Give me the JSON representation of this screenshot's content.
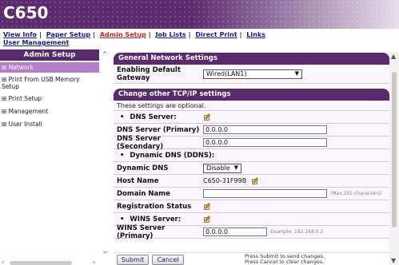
{
  "app": {
    "title": "C650"
  },
  "nav": {
    "line1": [
      "View Info",
      "Paper Setup",
      "Admin Setup",
      "Job Lists",
      "Direct Print",
      "Links"
    ],
    "line2": "User Management"
  },
  "sidebar": {
    "title": "Admin Setup",
    "items": [
      {
        "label": "⊞ Network"
      },
      {
        "label": "⊞ Print From USB Memory Setup"
      },
      {
        "label": "⊞ Print Setup"
      },
      {
        "label": "⊞ Management"
      },
      {
        "label": "⊞ User Install"
      }
    ]
  },
  "sections": {
    "general": {
      "title": "General Network Settings",
      "gateway_label": "Enabling Default Gateway",
      "gateway_value": "Wired(LAN1)"
    },
    "tcpip": {
      "title": "Change other TCP/IP settings",
      "note": "These settings are optional.",
      "dns_server_label": "DNS Server:",
      "dns_primary_label": "DNS Server (Primary)",
      "dns_primary_value": "0.0.0.0",
      "dns_secondary_label": "DNS Server (Secondary)",
      "dns_secondary_value": "0.0.0.0",
      "ddns_label": "Dynamic DNS (DDNS):",
      "dynamic_dns_label": "Dynamic DNS",
      "dynamic_dns_value": "Disable",
      "host_name_label": "Host Name",
      "host_name_value": "C650-31F99B",
      "domain_name_label": "Domain Name",
      "domain_name_value": "",
      "domain_name_hint": "(Max.255 characters)",
      "reg_status_label": "Registration Status",
      "wins_server_label": "WINS Server:",
      "wins_primary_label": "WINS Server (Primary)",
      "wins_primary_value": "0.0.0.0",
      "wins_primary_hint": "Example: 192.168.0.2"
    }
  },
  "actions": {
    "submit": "Submit",
    "cancel": "Cancel",
    "press_submit": "Press Submit to send changes.",
    "press_cancel": "Press Cancel to clear changes."
  },
  "colors": {
    "header": "#5b2a6e",
    "sidebar_active": "#b57ec8",
    "row_bg": "#fbf6fd",
    "link": "#1a1a8c",
    "link_active": "#c0282a"
  },
  "icons": {
    "edit": "edit-icon",
    "scroll_up": "chevron-up-icon",
    "scroll_down": "chevron-down-icon"
  }
}
